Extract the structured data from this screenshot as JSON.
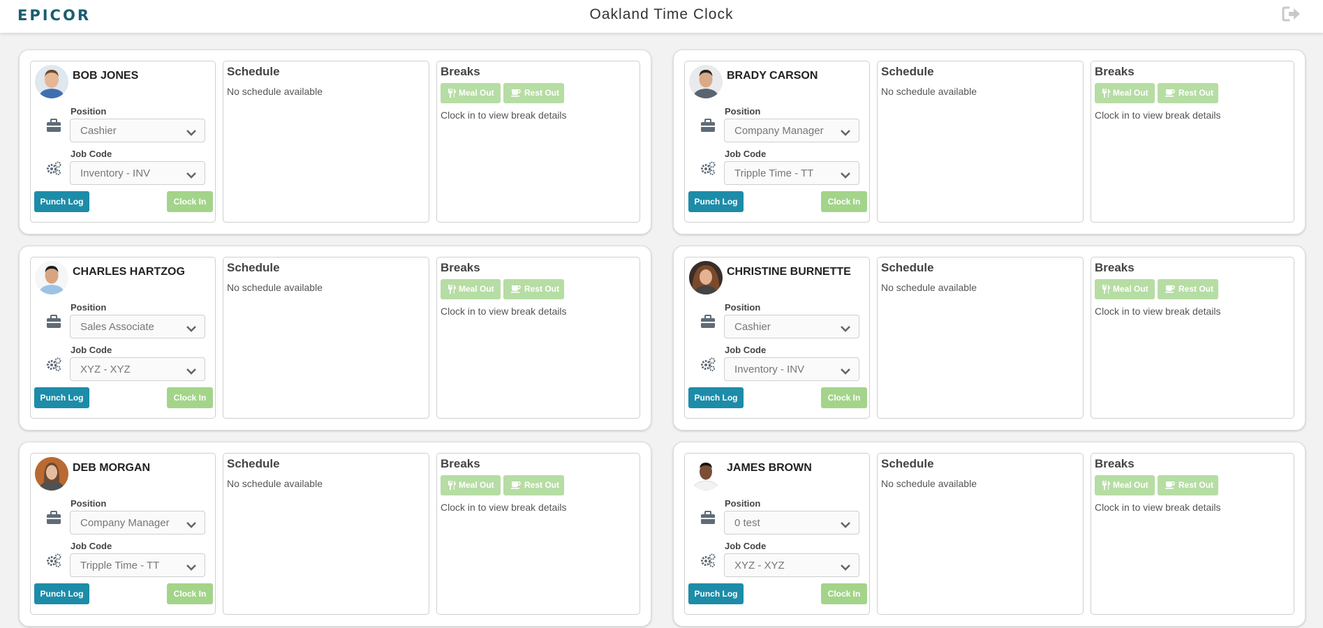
{
  "header": {
    "logo": "EPICOR",
    "title": "Oakland Time Clock",
    "logout_icon": "sign-out-icon"
  },
  "labels": {
    "position": "Position",
    "job_code": "Job Code",
    "punch_log": "Punch Log",
    "clock_in": "Clock In",
    "schedule": "Schedule",
    "no_schedule": "No schedule available",
    "breaks": "Breaks",
    "meal_out": "Meal Out",
    "rest_out": "Rest Out",
    "break_hint": "Clock in to view break details"
  },
  "colors": {
    "brand": "#1a5d6e",
    "punch_log": "#1d8ca8",
    "clock_in": "#a3d48a",
    "break_button": "#b6dda3"
  },
  "employees": [
    {
      "name": "BOB JONES",
      "position": "Cashier",
      "job_code": "Inventory - INV"
    },
    {
      "name": "BRADY CARSON",
      "position": "Company Manager",
      "job_code": "Tripple Time - TT"
    },
    {
      "name": "CHARLES HARTZOG",
      "position": "Sales Associate",
      "job_code": "XYZ - XYZ"
    },
    {
      "name": "CHRISTINE BURNETTE",
      "position": "Cashier",
      "job_code": "Inventory - INV"
    },
    {
      "name": "DEB MORGAN",
      "position": "Company Manager",
      "job_code": "Tripple Time - TT"
    },
    {
      "name": "JAMES BROWN",
      "position": "0 test",
      "job_code": "XYZ - XYZ"
    }
  ]
}
